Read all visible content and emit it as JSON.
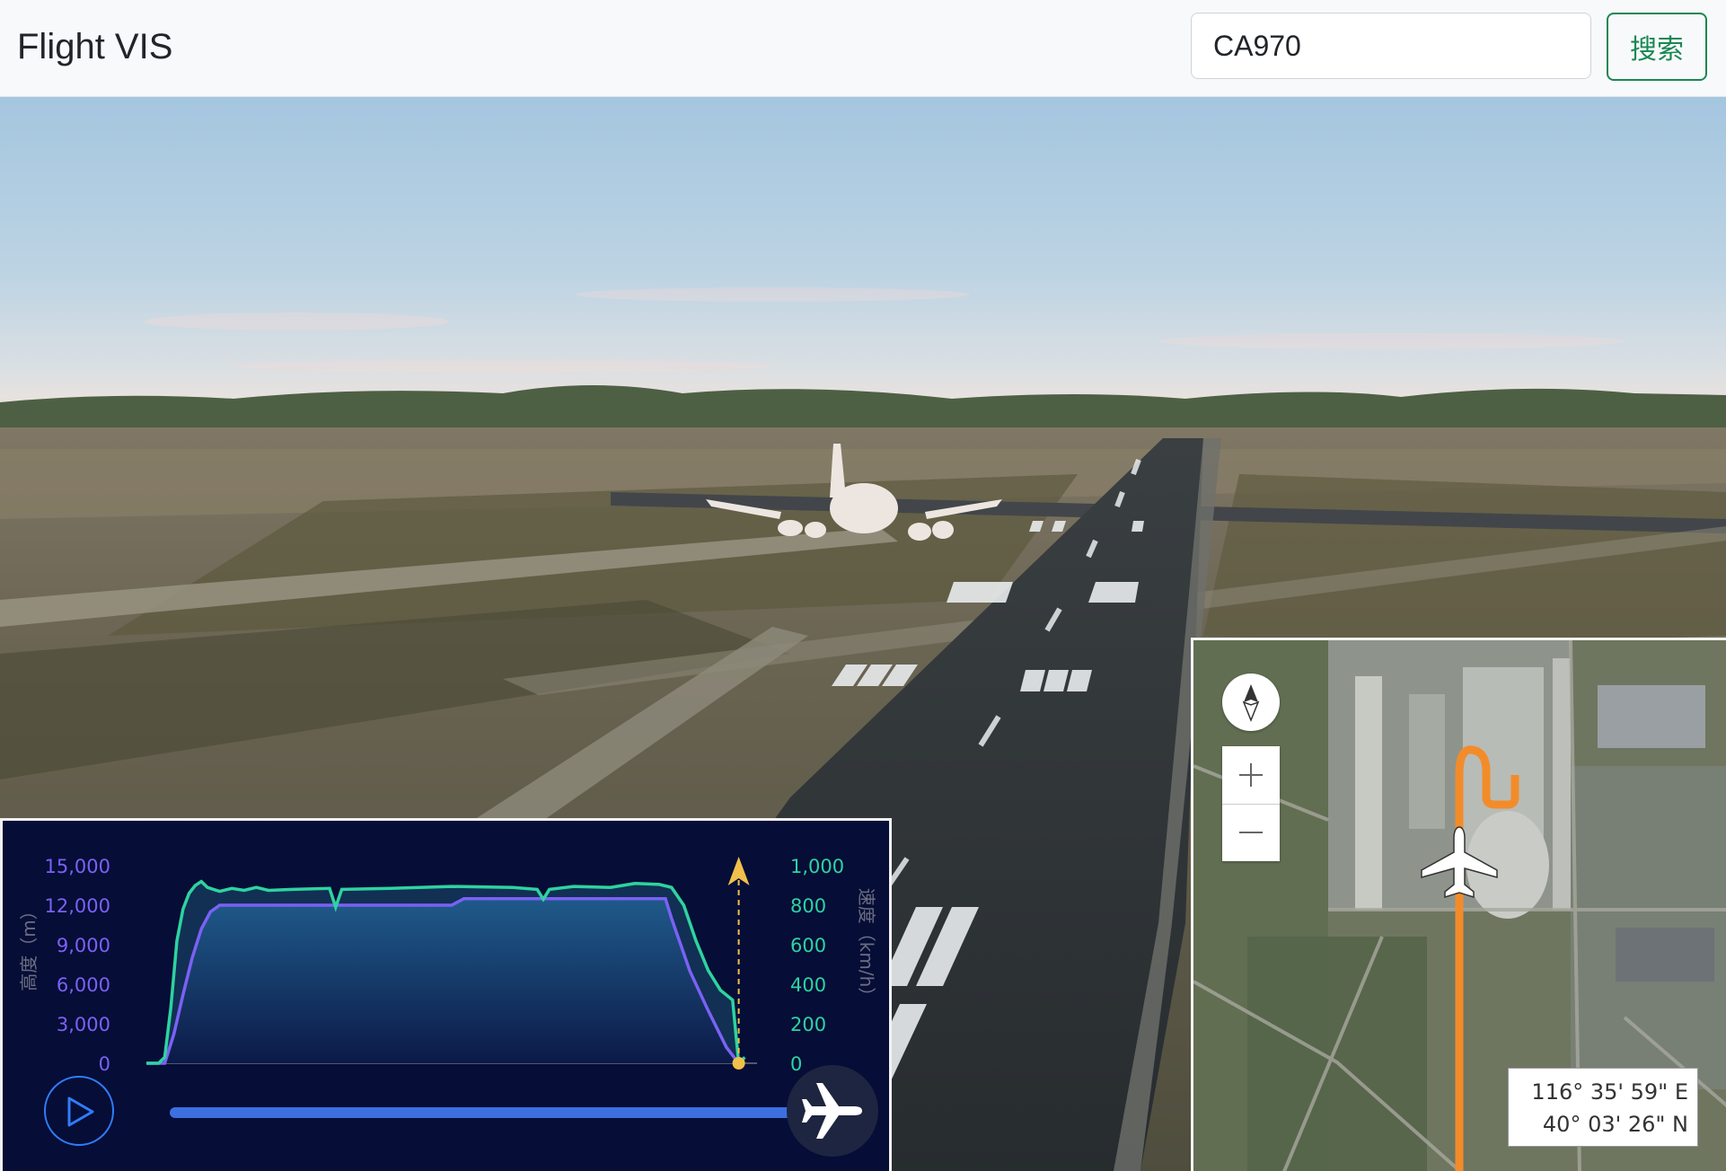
{
  "header": {
    "brand": "Flight VIS",
    "search_value": "CA970",
    "search_button_label": "搜索"
  },
  "chart_panel": {
    "left_axis": {
      "label": "高度（m）",
      "ticks": [
        "0",
        "3,000",
        "6,000",
        "9,000",
        "12,000",
        "15,000"
      ],
      "color": "#7b61f5"
    },
    "right_axis": {
      "label": "速度（km/h）",
      "ticks": [
        "0",
        "200",
        "400",
        "600",
        "800",
        "1,000"
      ],
      "color": "#2ed3a0"
    },
    "play_icon": "play-icon",
    "handle_icon": "airplane-icon",
    "playback_progress": 1.0
  },
  "chart_data": {
    "type": "area",
    "x_range": [
      0,
      100
    ],
    "altitude_range_m": [
      0,
      15000
    ],
    "speed_range_kmh": [
      0,
      1000
    ],
    "series": [
      {
        "axis": "left",
        "color": "#7b61f5",
        "points": [
          [
            0,
            0
          ],
          [
            2,
            0
          ],
          [
            3,
            0
          ],
          [
            4.5,
            2200
          ],
          [
            6,
            5200
          ],
          [
            7.5,
            8000
          ],
          [
            9,
            10200
          ],
          [
            10.5,
            11500
          ],
          [
            12,
            12000
          ],
          [
            30,
            12000
          ],
          [
            50,
            12000
          ],
          [
            52,
            12500
          ],
          [
            66,
            12500
          ],
          [
            85,
            12500
          ],
          [
            86,
            11000
          ],
          [
            89,
            7000
          ],
          [
            92,
            4000
          ],
          [
            95,
            1200
          ],
          [
            97,
            0
          ],
          [
            98,
            0
          ]
        ]
      },
      {
        "axis": "right",
        "color": "#2ed3a0",
        "points": [
          [
            0,
            0
          ],
          [
            2,
            0
          ],
          [
            3,
            30
          ],
          [
            4,
            280
          ],
          [
            5,
            620
          ],
          [
            6,
            780
          ],
          [
            7,
            860
          ],
          [
            8,
            900
          ],
          [
            9,
            920
          ],
          [
            10,
            890
          ],
          [
            11,
            880
          ],
          [
            12,
            870
          ],
          [
            14,
            885
          ],
          [
            16,
            875
          ],
          [
            18,
            890
          ],
          [
            20,
            875
          ],
          [
            24,
            880
          ],
          [
            30,
            885
          ],
          [
            31,
            790
          ],
          [
            32,
            880
          ],
          [
            40,
            885
          ],
          [
            50,
            895
          ],
          [
            60,
            890
          ],
          [
            64,
            880
          ],
          [
            65,
            830
          ],
          [
            66,
            880
          ],
          [
            70,
            895
          ],
          [
            76,
            890
          ],
          [
            80,
            910
          ],
          [
            84,
            905
          ],
          [
            86,
            890
          ],
          [
            88,
            800
          ],
          [
            90,
            620
          ],
          [
            92,
            470
          ],
          [
            94,
            370
          ],
          [
            96,
            320
          ],
          [
            97,
            0
          ],
          [
            98,
            30
          ]
        ]
      }
    ],
    "current_marker": 97
  },
  "minimap": {
    "compass_icon": "compass-icon",
    "zoom_in_icon": "plus-icon",
    "zoom_out_icon": "minus-icon",
    "longitude": "116° 35' 59\" E",
    "latitude": "40° 03' 26\" N",
    "track_color": "#f28c2b"
  },
  "scene": {
    "sky_top_color": "#a9c9df",
    "horizon_color": "#e8e4df",
    "ground_color": "#5e5b49",
    "runway_color": "#2c3134"
  }
}
